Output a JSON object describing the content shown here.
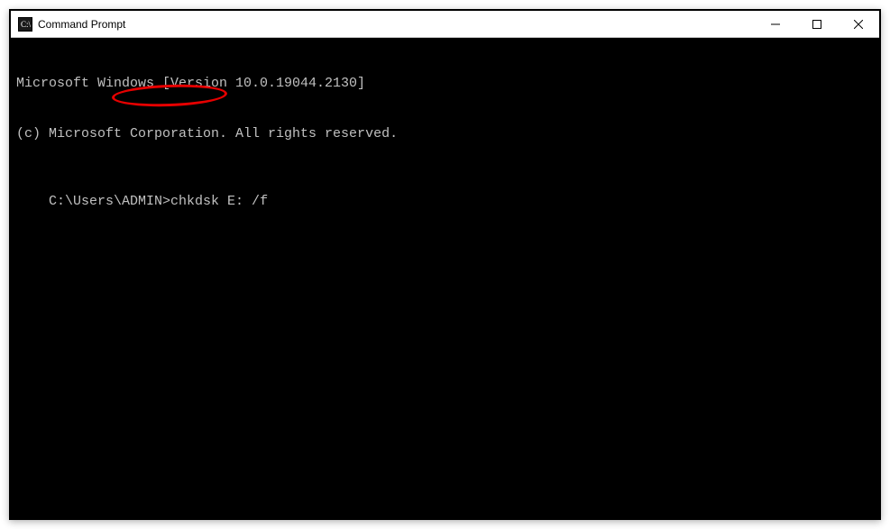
{
  "window": {
    "title": "Command Prompt"
  },
  "terminal": {
    "line1": "Microsoft Windows [Version 10.0.19044.2130]",
    "line2": "(c) Microsoft Corporation. All rights reserved.",
    "blank": "",
    "prompt_prefix": "C:\\Users\\ADMIN>",
    "command": "chkdsk E: /f"
  },
  "annotation": {
    "ellipse_color": "#e60000"
  }
}
